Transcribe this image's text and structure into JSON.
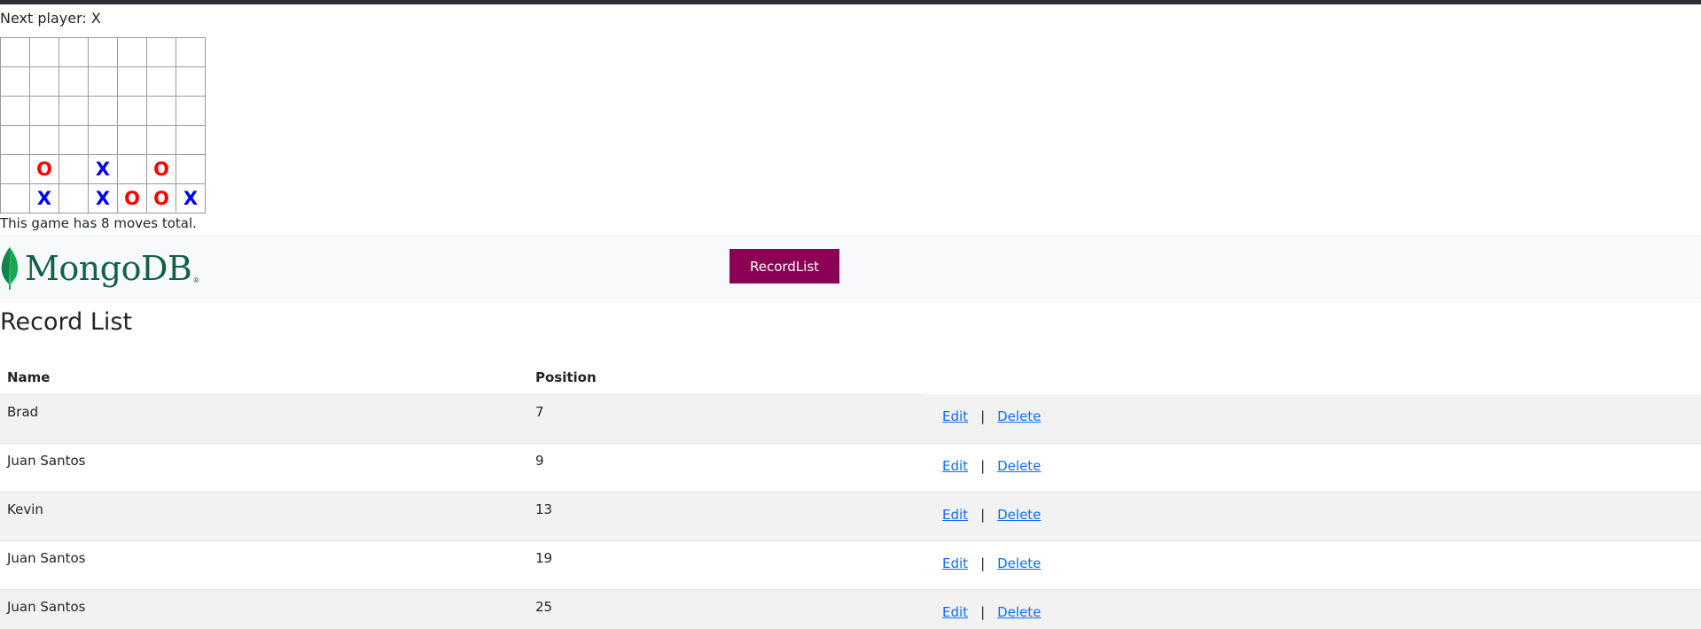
{
  "game": {
    "status": "Next player: X",
    "board": [
      [
        "",
        "",
        "",
        "",
        "",
        "",
        ""
      ],
      [
        "",
        "",
        "",
        "",
        "",
        "",
        ""
      ],
      [
        "",
        "",
        "",
        "",
        "",
        "",
        ""
      ],
      [
        "",
        "",
        "",
        "",
        "",
        "",
        ""
      ],
      [
        "",
        "O",
        "",
        "X",
        "",
        "O",
        ""
      ],
      [
        "",
        "X",
        "",
        "X",
        "O",
        "O",
        "X"
      ]
    ],
    "moves_text": "This game has 8 moves total.",
    "colors": {
      "X": "#0000ff",
      "O": "#ff0000"
    }
  },
  "navbar": {
    "brand_text": "MongoDB",
    "brand_mark": "®",
    "logo_icon": "mongodb-leaf-icon",
    "button_label": "RecordList",
    "button_color": "#8b0054",
    "brand_color": "#116149"
  },
  "record_list": {
    "title": "Record List",
    "columns": [
      "Name",
      "Position"
    ],
    "rows": [
      {
        "name": "Brad",
        "position": "7",
        "edit": "Edit",
        "delete": "Delete"
      },
      {
        "name": "Juan Santos",
        "position": "9",
        "edit": "Edit",
        "delete": "Delete"
      },
      {
        "name": "Kevin",
        "position": "13",
        "edit": "Edit",
        "delete": "Delete"
      },
      {
        "name": "Juan Santos",
        "position": "19",
        "edit": "Edit",
        "delete": "Delete"
      },
      {
        "name": "Juan Santos",
        "position": "25",
        "edit": "Edit",
        "delete": "Delete"
      }
    ],
    "separator": "|"
  }
}
